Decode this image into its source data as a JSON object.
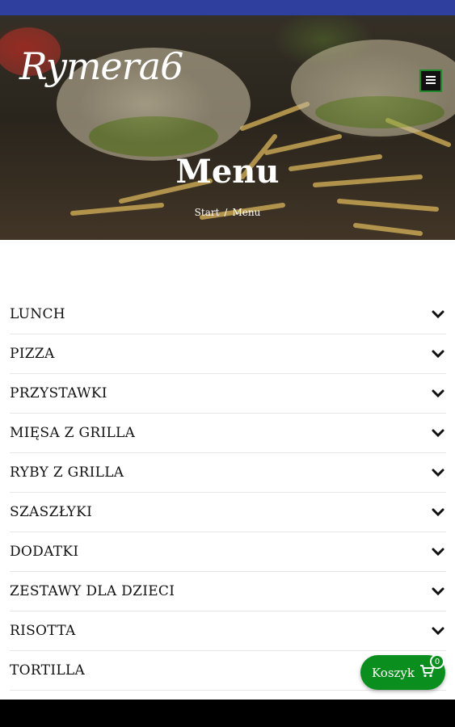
{
  "brand": {
    "logo_text": "Rymera6"
  },
  "hero": {
    "title": "Menu",
    "breadcrumb": {
      "home": "Start",
      "separator": "/",
      "current": "Menu"
    }
  },
  "accordion": {
    "items": [
      {
        "label": "LUNCH"
      },
      {
        "label": "PIZZA"
      },
      {
        "label": "PRZYSTAWKI"
      },
      {
        "label": "MIĘSA Z GRILLA"
      },
      {
        "label": "RYBY Z GRILLA"
      },
      {
        "label": "SZASZŁYKI"
      },
      {
        "label": "DODATKI"
      },
      {
        "label": "ZESTAWY DLA DZIECI"
      },
      {
        "label": "RISOTTA"
      },
      {
        "label": "TORTILLA"
      }
    ]
  },
  "cart": {
    "label": "Koszyk",
    "count": "0"
  },
  "colors": {
    "accent": "#0a8f1f",
    "status_bar": "#2f3f9e"
  },
  "icons": {
    "menu": "hamburger-icon",
    "chevron": "chevron-down-icon",
    "cart": "cart-icon"
  }
}
